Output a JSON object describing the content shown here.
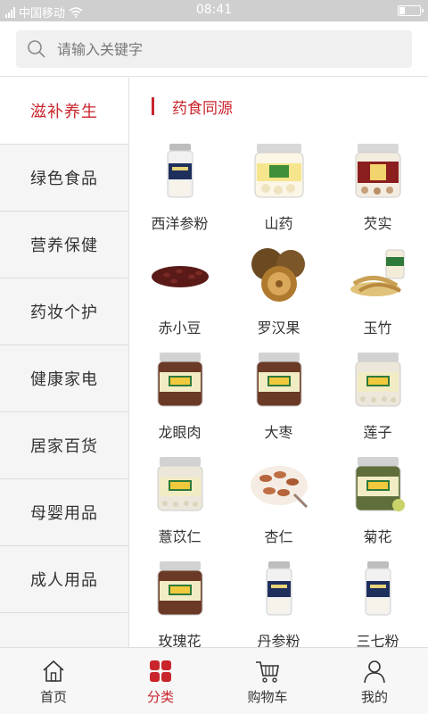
{
  "status_bar": {
    "carrier": "中国移动",
    "time": "08:41"
  },
  "search": {
    "placeholder": "请输入关键字"
  },
  "sidebar": {
    "items": [
      {
        "label": "滋补养生"
      },
      {
        "label": "绿色食品"
      },
      {
        "label": "营养保健"
      },
      {
        "label": "药妆个护"
      },
      {
        "label": "健康家电"
      },
      {
        "label": "居家百货"
      },
      {
        "label": "母婴用品"
      },
      {
        "label": "成人用品"
      }
    ]
  },
  "section": {
    "title": "药食同源"
  },
  "products": [
    {
      "name": "西洋参粉",
      "kind": "jar-tall"
    },
    {
      "name": "山药",
      "kind": "jar-wide"
    },
    {
      "name": "芡实",
      "kind": "jar-red"
    },
    {
      "name": "赤小豆",
      "kind": "beans"
    },
    {
      "name": "罗汉果",
      "kind": "fruit"
    },
    {
      "name": "玉竹",
      "kind": "slices"
    },
    {
      "name": "龙眼肉",
      "kind": "jar-brown"
    },
    {
      "name": "大枣",
      "kind": "jar-brown"
    },
    {
      "name": "莲子",
      "kind": "jar-light"
    },
    {
      "name": "薏苡仁",
      "kind": "jar-light"
    },
    {
      "name": "杏仁",
      "kind": "almonds"
    },
    {
      "name": "菊花",
      "kind": "jar-green"
    },
    {
      "name": "玫瑰花",
      "kind": "jar-brown"
    },
    {
      "name": "丹参粉",
      "kind": "jar-tall"
    },
    {
      "name": "三七粉",
      "kind": "jar-tall"
    }
  ],
  "tabbar": {
    "tabs": [
      {
        "label": "首页",
        "icon": "home-icon"
      },
      {
        "label": "分类",
        "icon": "category-icon"
      },
      {
        "label": "购物车",
        "icon": "cart-icon"
      },
      {
        "label": "我的",
        "icon": "user-icon"
      }
    ]
  },
  "colors": {
    "accent": "#c9252c",
    "sidebar_bg": "#f5f5f5"
  }
}
